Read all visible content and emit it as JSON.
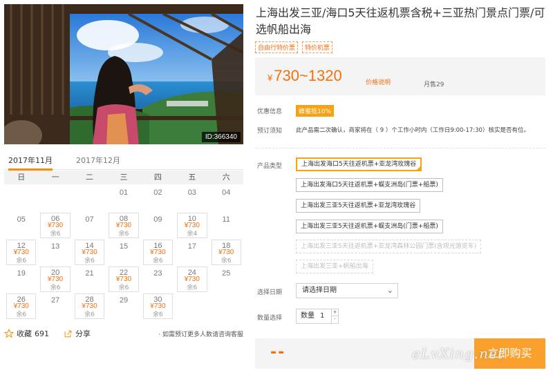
{
  "photo": {
    "id_label": "ID:366340"
  },
  "month_tabs": [
    {
      "label": "2017年11月",
      "active": true
    },
    {
      "label": "2017年12月",
      "active": false
    }
  ],
  "weekdays": [
    "日",
    "一",
    "二",
    "三",
    "四",
    "五",
    "六"
  ],
  "calendar": {
    "weeks": [
      [
        {},
        {},
        {},
        {
          "day": "01"
        },
        {
          "day": "02"
        },
        {
          "day": "03"
        },
        {
          "day": "04"
        }
      ],
      [
        {
          "day": "05"
        },
        {
          "day": "06",
          "price": "¥730",
          "stock": "余6"
        },
        {
          "day": "07"
        },
        {
          "day": "08",
          "price": "¥730",
          "stock": "余6"
        },
        {
          "day": "09"
        },
        {
          "day": "10",
          "price": "¥730",
          "stock": "余4"
        },
        {
          "day": "11"
        }
      ],
      [
        {
          "day": "12",
          "price": "¥730",
          "stock": "余6"
        },
        {
          "day": "13"
        },
        {
          "day": "14",
          "price": "¥730",
          "stock": "余6"
        },
        {
          "day": "15"
        },
        {
          "day": "16",
          "price": "¥730",
          "stock": "余6"
        },
        {
          "day": "17"
        },
        {
          "day": "18",
          "price": "¥730",
          "stock": "余6"
        }
      ],
      [
        {
          "day": "19"
        },
        {
          "day": "20",
          "price": "¥730",
          "stock": "余6"
        },
        {
          "day": "21"
        },
        {
          "day": "22",
          "price": "¥730",
          "stock": "余6"
        },
        {
          "day": "23"
        },
        {
          "day": "24",
          "price": "¥730",
          "stock": "余6"
        },
        {
          "day": "25"
        }
      ],
      [
        {
          "day": "26",
          "price": "¥730",
          "stock": "余6"
        },
        {
          "day": "27"
        },
        {
          "day": "28",
          "price": "¥730",
          "stock": "余6"
        },
        {
          "day": "29"
        },
        {
          "day": "30",
          "price": "¥730",
          "stock": "余6"
        },
        {},
        {}
      ]
    ]
  },
  "social": {
    "favorite_label": "收藏",
    "favorite_count": "691",
    "share_label": "分享",
    "consult_note": "· 如需预订更多人数请咨询客服"
  },
  "product": {
    "title": "上海出发三亚/海口5天往返机票含税+三亚热门景点门票/可选帆船出海",
    "tags": [
      "自由行特价票",
      "特价机票"
    ],
    "price_range": "730~1320",
    "currency": "¥",
    "price_note": "价格说明",
    "sold": "月售29"
  },
  "labels": {
    "discount": "优惠信息",
    "notice": "预订须知",
    "product_type": "产品类型",
    "choose_date": "选择日期",
    "quantity": "数量选择"
  },
  "discount_badge": "蜂蜜抵10%",
  "notice_text": "此产品需二次确认，商家将在（ 9 ）个工作小时内（工作日9:00-17:30）核实是否有位。",
  "options": [
    {
      "label": "上海出发海口5天往返机票+亚龙湾玫瑰谷",
      "state": "selected"
    },
    {
      "label": "上海出发海口5天往返机票+蜈支洲岛(门票+船票)",
      "state": "normal"
    },
    {
      "label": "上海出发三亚5天往返机票+亚龙湾玫瑰谷",
      "state": "normal"
    },
    {
      "label": "上海出发三亚5天往返机票+蜈支洲岛(门票+船票)",
      "state": "normal"
    },
    {
      "label": "上海出发三亚5天往返机票+亚龙湾森林公园门票(含观光游览车)",
      "state": "disabled"
    },
    {
      "label": "上海出发三亚+帆船出海",
      "state": "disabled"
    }
  ],
  "date_select": {
    "placeholder": "请选择日期"
  },
  "quantity": {
    "label": "数量",
    "value": "1"
  },
  "total": "--",
  "buy_label": "立即购买",
  "watermark": "eLvXing.net"
}
